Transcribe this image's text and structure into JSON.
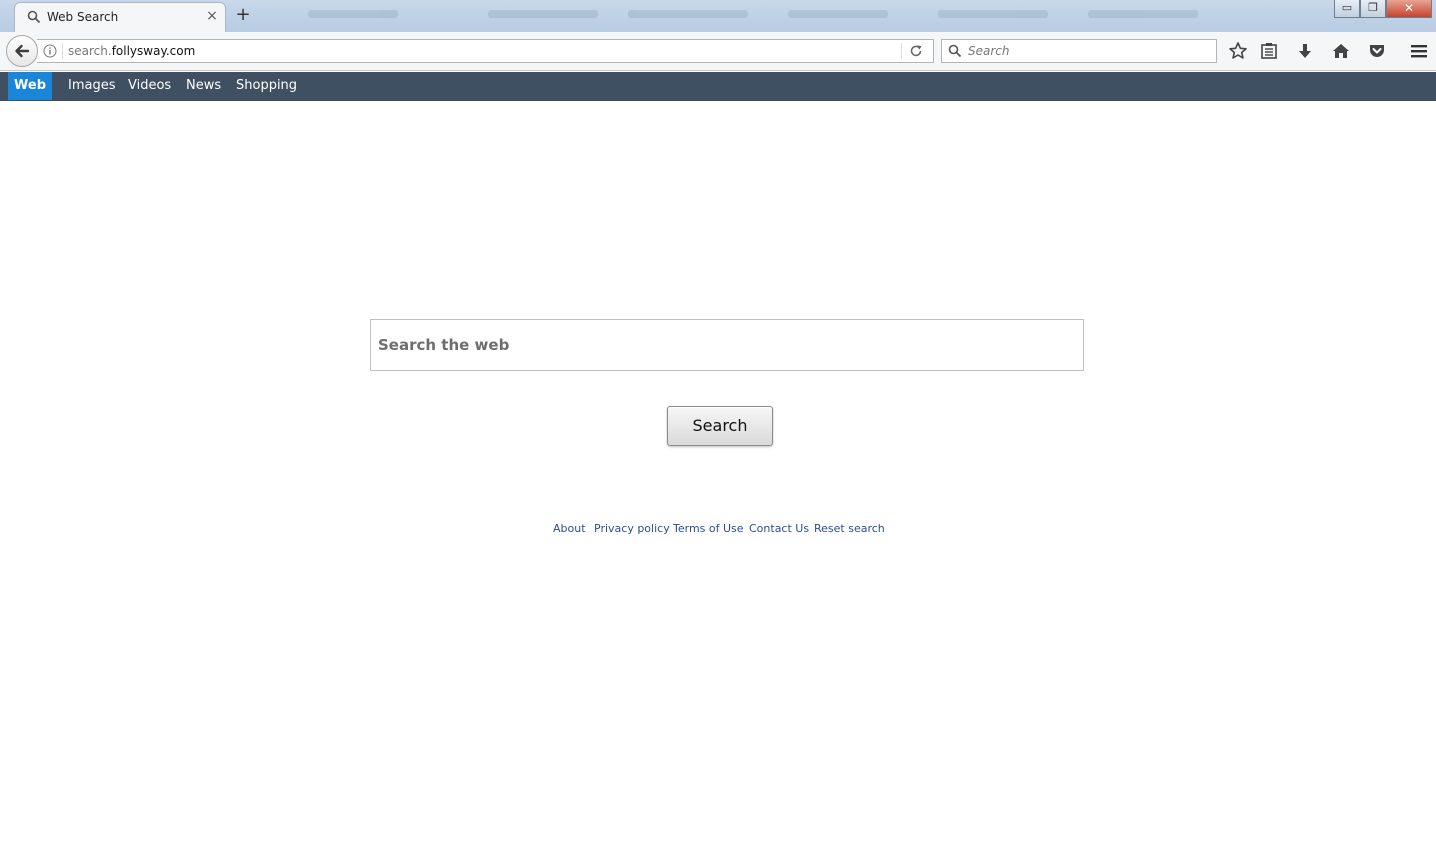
{
  "browser": {
    "tab": {
      "title": "Web Search",
      "close_label": "×",
      "icon": "search-icon"
    },
    "new_tab_label": "+",
    "window_controls": {
      "minimize_label": "▭",
      "restore_label": "❐",
      "close_label": "✕"
    },
    "url": {
      "host_prefix": "search.",
      "host_domain": "follysway.com"
    },
    "search_bar": {
      "placeholder": "Search"
    },
    "toolbar_icons": [
      "star-icon",
      "reading-list-icon",
      "download-icon",
      "home-icon",
      "pocket-icon",
      "menu-icon"
    ]
  },
  "category_nav": {
    "items": [
      {
        "label": "Web",
        "active": true
      },
      {
        "label": "Images",
        "active": false
      },
      {
        "label": "Videos",
        "active": false
      },
      {
        "label": "News",
        "active": false
      },
      {
        "label": "Shopping",
        "active": false
      }
    ]
  },
  "main": {
    "search_placeholder": "Search the web",
    "search_button_label": "Search"
  },
  "footer": {
    "links": [
      "About",
      "Privacy policy",
      "Terms of Use",
      "Contact Us",
      "Reset search"
    ]
  },
  "colors": {
    "nav_bg": "#3e5062",
    "active_tab": "#1a86d9",
    "footer_link": "#2a4f8f"
  }
}
